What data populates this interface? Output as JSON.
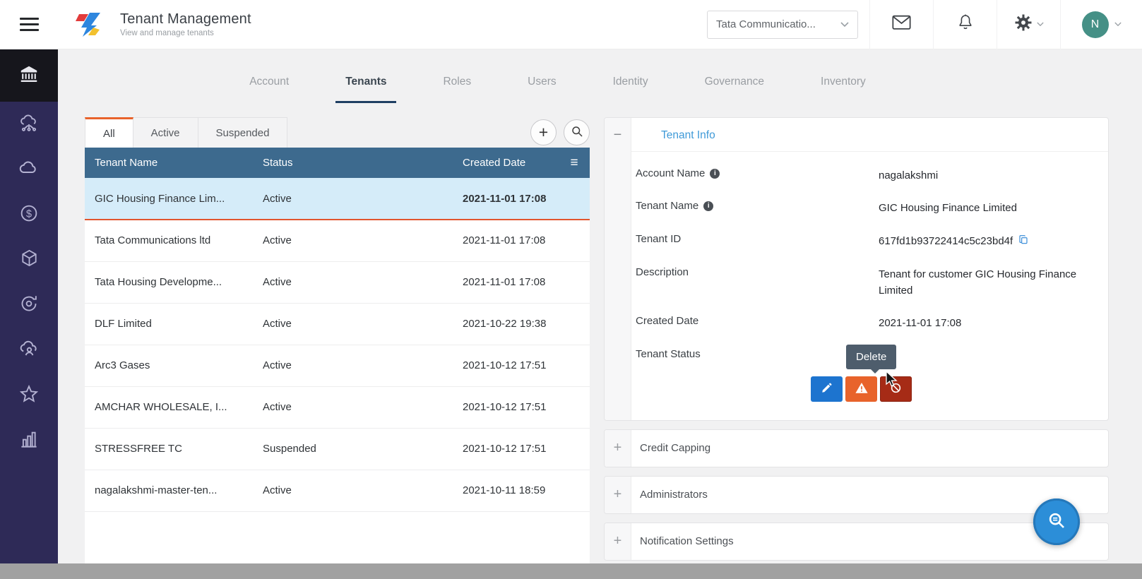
{
  "colors": {
    "sidebar_bg": "#2e2a57",
    "sidebar_tile_bg": "#16161c",
    "table_header_bg": "#3d6a8e",
    "selected_row_bg": "#d5ecf9",
    "selected_row_border": "#e2552e",
    "active_filter_accent": "#e8632b",
    "active_nav_underline": "#1f3f63",
    "section_title_blue": "#3f9ad8",
    "edit_button": "#1d74cf",
    "warning_button": "#e8632b",
    "delete_button": "#a62b16",
    "tooltip_bg": "#4e5d6c",
    "fab_bg": "#2c8ed8",
    "avatar_bg": "#459086"
  },
  "header": {
    "title": "Tenant Management",
    "subtitle": "View and manage tenants",
    "org_selector_value": "Tata Communicatio...",
    "icons": [
      "mail-icon",
      "bell-icon",
      "gear-icon"
    ],
    "avatar_initial": "N"
  },
  "sidebar": {
    "items": [
      "institution",
      "cloud-network",
      "cloud",
      "billing-dollar",
      "package-cube",
      "settings-sync",
      "cloud-users",
      "favorites-star",
      "analytics-chart"
    ]
  },
  "nav": {
    "tabs": [
      {
        "label": "Account",
        "active": false
      },
      {
        "label": "Tenants",
        "active": true
      },
      {
        "label": "Roles",
        "active": false
      },
      {
        "label": "Users",
        "active": false
      },
      {
        "label": "Identity",
        "active": false
      },
      {
        "label": "Governance",
        "active": false
      },
      {
        "label": "Inventory",
        "active": false
      }
    ]
  },
  "tenant_list": {
    "filters": [
      {
        "label": "All",
        "active": true
      },
      {
        "label": "Active",
        "active": false
      },
      {
        "label": "Suspended",
        "active": false
      }
    ],
    "toolbar": {
      "add_icon": "plus",
      "search_icon": "magnifier",
      "add_label": "+"
    },
    "columns": [
      "Tenant Name",
      "Status",
      "Created Date"
    ],
    "column_menu_icon": "≡",
    "rows": [
      {
        "name": "GIC Housing Finance Lim...",
        "status": "Active",
        "created": "2021-11-01 17:08",
        "selected": true
      },
      {
        "name": "Tata Communications ltd",
        "status": "Active",
        "created": "2021-11-01 17:08",
        "selected": false
      },
      {
        "name": "Tata Housing Developme...",
        "status": "Active",
        "created": "2021-11-01 17:08",
        "selected": false
      },
      {
        "name": "DLF Limited",
        "status": "Active",
        "created": "2021-10-22 19:38",
        "selected": false
      },
      {
        "name": "Arc3 Gases",
        "status": "Active",
        "created": "2021-10-12 17:51",
        "selected": false
      },
      {
        "name": "AMCHAR WHOLESALE, I...",
        "status": "Active",
        "created": "2021-10-12 17:51",
        "selected": false
      },
      {
        "name": "STRESSFREE TC",
        "status": "Suspended",
        "created": "2021-10-12 17:51",
        "selected": false
      },
      {
        "name": "nagalakshmi-master-ten...",
        "status": "Active",
        "created": "2021-10-11 18:59",
        "selected": false
      }
    ]
  },
  "tenant_info": {
    "collapse_icon": "−",
    "title": "Tenant Info",
    "fields": [
      {
        "label": "Account Name",
        "value": "nagalakshmi",
        "info_icon": true
      },
      {
        "label": "Tenant Name",
        "value": "GIC Housing Finance Limited",
        "info_icon": true
      },
      {
        "label": "Tenant ID",
        "value": "617fd1b93722414c5c23bd4f",
        "copy_icon": true
      },
      {
        "label": "Description",
        "value": "Tenant for customer GIC Housing Finance Limited"
      },
      {
        "label": "Created Date",
        "value": "2021-11-01 17:08"
      },
      {
        "label": "Tenant Status",
        "value": ""
      }
    ],
    "info_icon_glyph": "i",
    "actions": [
      "edit-pencil",
      "suspend-warning",
      "delete-cancel"
    ],
    "tooltip": "Delete"
  },
  "accordion_sections": [
    {
      "label": "Credit Capping",
      "expand_icon": "+"
    },
    {
      "label": "Administrators",
      "expand_icon": "+"
    },
    {
      "label": "Notification Settings",
      "expand_icon": "+"
    }
  ]
}
